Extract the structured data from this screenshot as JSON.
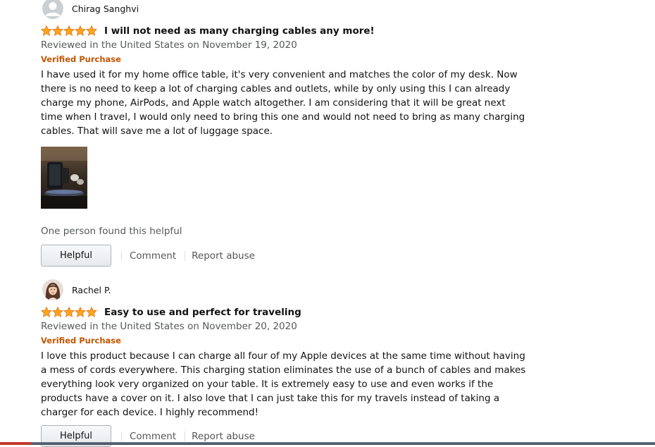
{
  "reviews": [
    {
      "author": "Chirag Sanghvi",
      "avatar": "default-user-icon",
      "rating": 5,
      "title": "I will not need as many charging cables any more!",
      "date": "Reviewed in the United States on November 19, 2020",
      "verified": "Verified Purchase",
      "body": "I have used it for my home office table, it's very convenient and matches the color of my desk. Now there is no need to keep a lot of charging cables and outlets, while by only using this I can already charge my phone, AirPods, and Apple watch altogether. I am considering that it will be great next time when I travel, I would only need to bring this one and would not need to bring as many charging cables. That will save me a lot of luggage space.",
      "has_image": true,
      "helpful_count": "One person found this helpful",
      "helpful_label": "Helpful",
      "comment_label": "Comment",
      "report_label": "Report abuse"
    },
    {
      "author": "Rachel P.",
      "avatar": "user-photo",
      "rating": 5,
      "title": "Easy to use and perfect for traveling",
      "date": "Reviewed in the United States on November 20, 2020",
      "verified": "Verified Purchase",
      "body": "I love this product because I can charge all four of my Apple devices at the same time without having a mess of cords everywhere. This charging station eliminates the use of a bunch of cables and makes everything look very organized on your table. It is extremely easy to use and even works if the products have a cover on it. I also love that I can just take this for my travels instead of taking a charger for each device. I highly recommend!",
      "helpful_label": "Helpful",
      "comment_label": "Comment",
      "report_label": "Report abuse"
    }
  ],
  "colors": {
    "star": "#ffa41c",
    "verified": "#c45500",
    "muted": "#565959"
  }
}
